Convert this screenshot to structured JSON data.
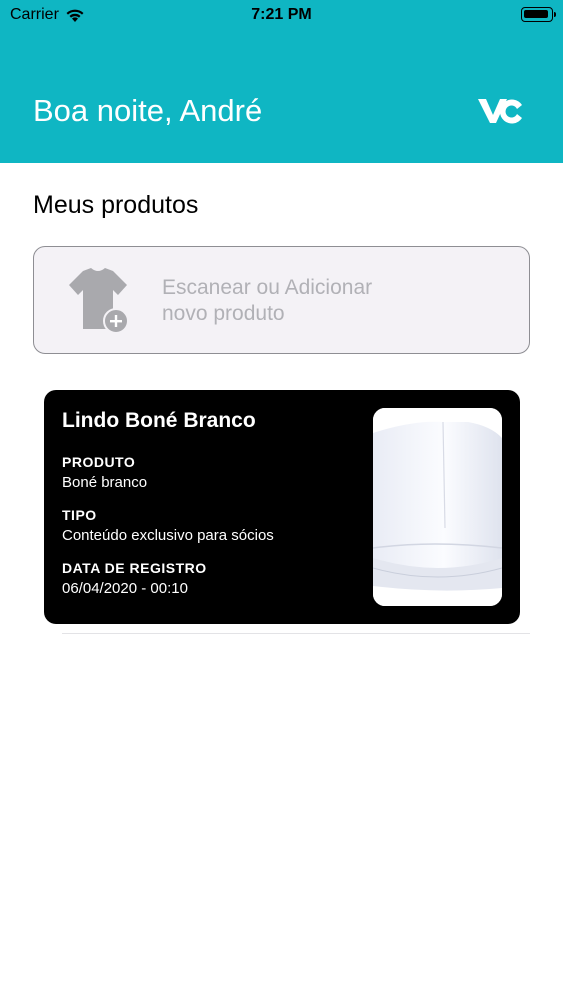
{
  "status_bar": {
    "carrier": "Carrier",
    "time": "7:21 PM"
  },
  "header": {
    "greeting": "Boa noite, André",
    "background_color": "#0fb6c3",
    "logo_icon": "vc-logo-icon"
  },
  "section": {
    "title": "Meus produtos"
  },
  "add_card": {
    "line1": "Escanear ou Adicionar",
    "line2": "novo produto",
    "icon": "tshirt-add-icon"
  },
  "product": {
    "name": "Lindo Boné Branco",
    "fields": [
      {
        "label": "PRODUTO",
        "value": "Boné branco"
      },
      {
        "label": "TIPO",
        "value": "Conteúdo exclusivo para sócios"
      },
      {
        "label": "DATA DE REGISTRO",
        "value": "06/04/2020 - 00:10"
      }
    ],
    "image_icon": "white-cap-image"
  }
}
